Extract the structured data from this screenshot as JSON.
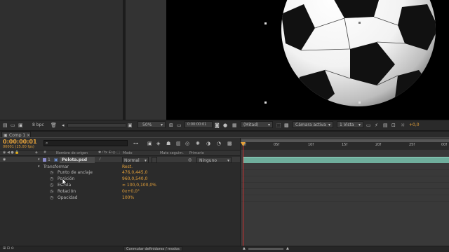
{
  "project_panel": {
    "bpc": "8 bpc"
  },
  "viewer": {
    "zoom": "50%",
    "timecode": "0:00:00:01",
    "resolution": "(Mitad)",
    "camera": "Cámara activa",
    "views": "1 Vista",
    "exposure": "+0,0"
  },
  "comp_tab": {
    "label": "Comp 1"
  },
  "timeline": {
    "current_time": "0:00:00:01",
    "frame_info": "00001 (25.00 fps)",
    "search_placeholder": "",
    "columns": {
      "source_name": "Nombre de origen",
      "mode": "Modo",
      "trkmat": "Mate seguim.",
      "parent": "Primario"
    },
    "ruler": {
      "start": "0f",
      "ticks": [
        "05f",
        "10f",
        "15f",
        "20f",
        "25f",
        "00f"
      ]
    },
    "layer": {
      "index": "1",
      "name": "Pelota.psd",
      "mode": "Normal",
      "parent": "Ninguno"
    },
    "transform": {
      "label": "Transformar",
      "reset": "Rest.",
      "properties": [
        {
          "name": "Punto de anclaje",
          "value": "476,0,445,0"
        },
        {
          "name": "Posición",
          "value": "960,0,540,0"
        },
        {
          "name": "Escala",
          "value": "∞ 100,0,100,0%"
        },
        {
          "name": "Rotación",
          "value": "0x+0,0°"
        },
        {
          "name": "Opacidad",
          "value": "100%"
        }
      ]
    },
    "footer": {
      "toggle": "Conmutar definidores / modos"
    }
  },
  "colors": {
    "accent": "#e6a23a",
    "panel": "#2b2b2b",
    "dark": "#1f1f1f",
    "layer_bar": "#6fae9c",
    "layer_label": "#8c8ccf"
  }
}
